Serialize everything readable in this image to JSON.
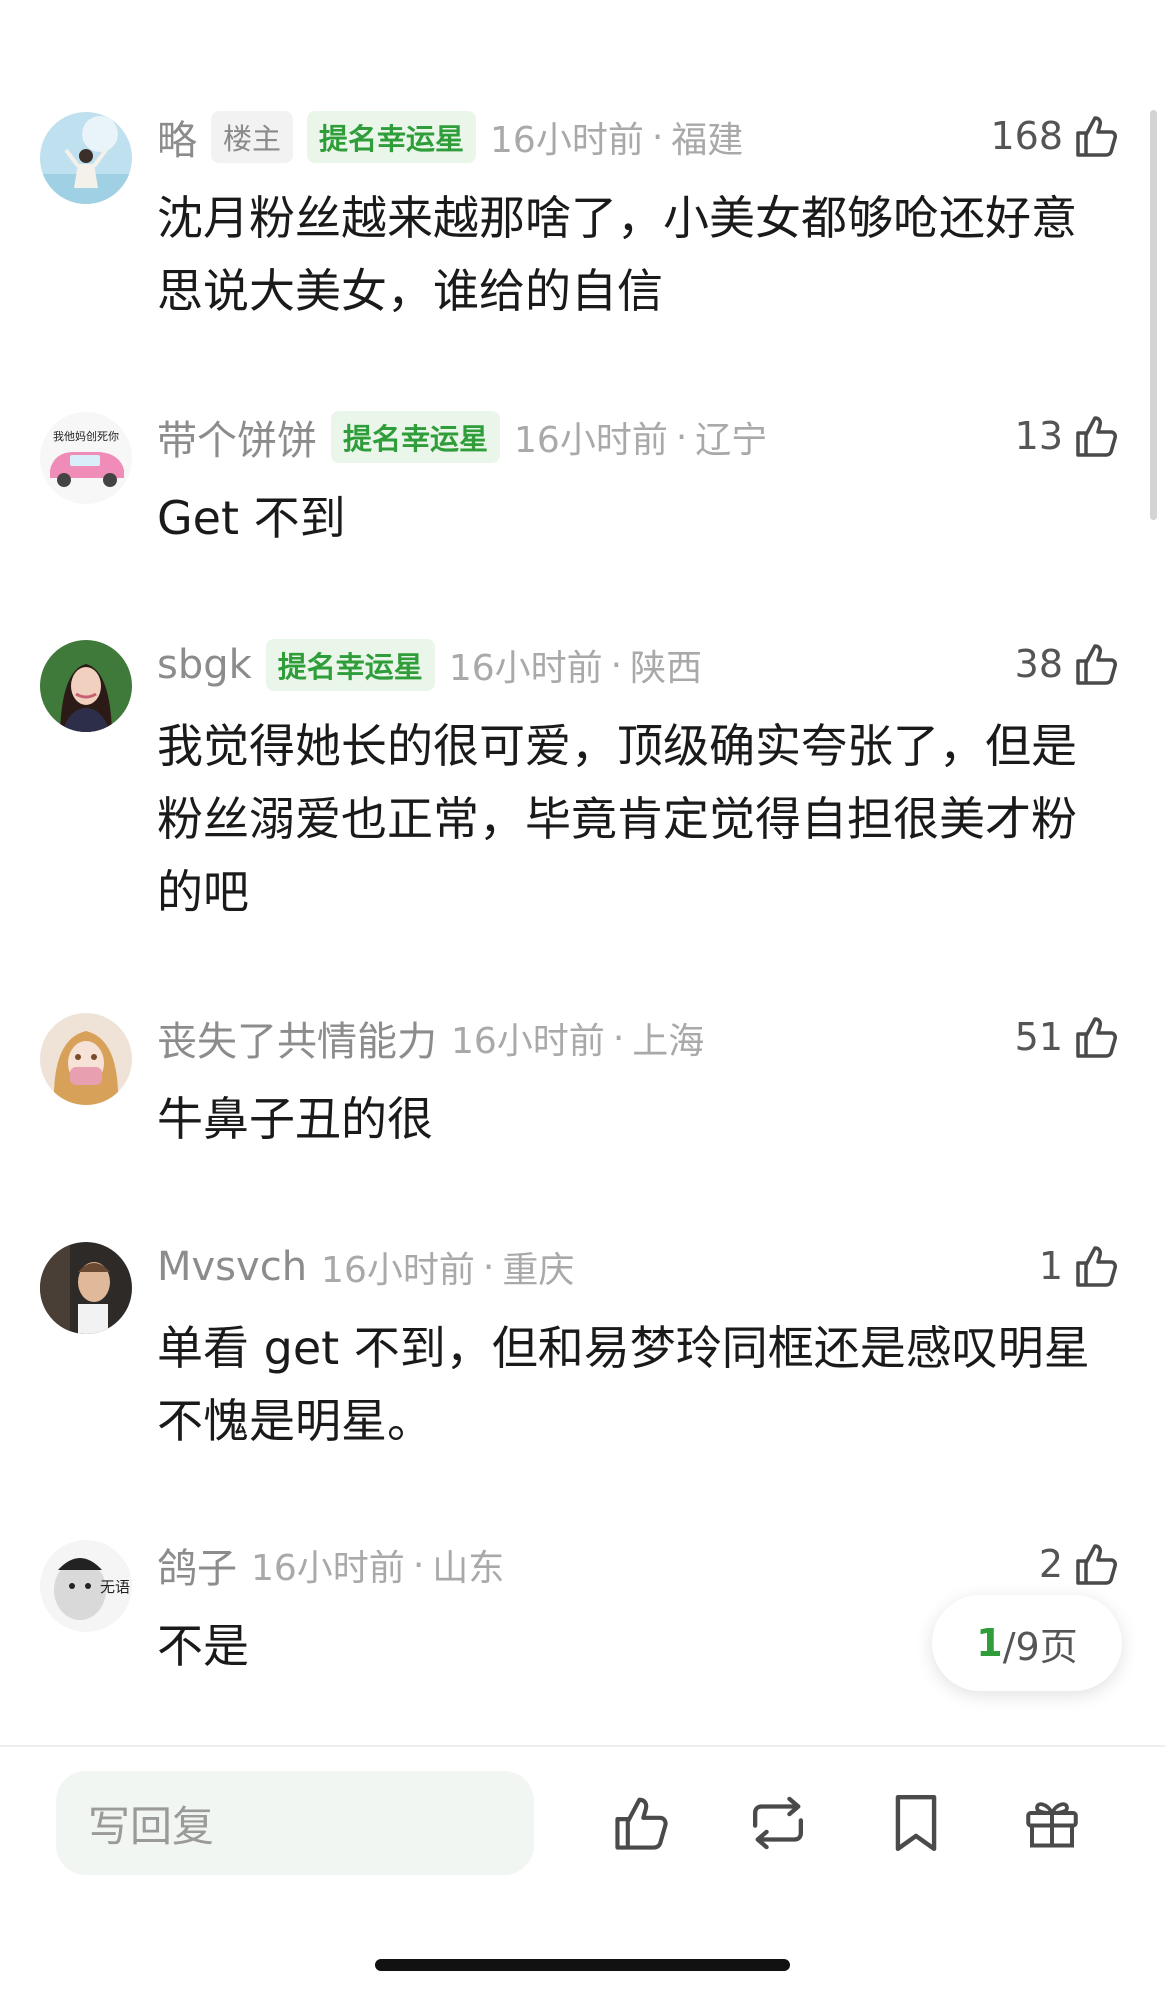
{
  "comments": [
    {
      "user": "略",
      "owner_badge": "楼主",
      "lucky_badge": "提名幸运星",
      "time": "16小时前",
      "region": "福建",
      "likes": "168",
      "text": "沈月粉丝越来越那啥了，小美女都够呛还好意思说大美女，谁给的自信"
    },
    {
      "user": "带个饼饼",
      "lucky_badge": "提名幸运星",
      "time": "16小时前",
      "region": "辽宁",
      "likes": "13",
      "text": "Get 不到",
      "avatar_text": "我他妈创死你"
    },
    {
      "user": "sbgk",
      "lucky_badge": "提名幸运星",
      "time": "16小时前",
      "region": "陕西",
      "likes": "38",
      "text": "我觉得她长的很可爱，顶级确实夸张了，但是粉丝溺爱也正常，毕竟肯定觉得自担很美才粉的吧"
    },
    {
      "user": "丧失了共情能力",
      "time": "16小时前",
      "region": "上海",
      "likes": "51",
      "text": "牛鼻子丑的很"
    },
    {
      "user": "Mvsvch",
      "time": "16小时前",
      "region": "重庆",
      "likes": "1",
      "text": "单看 get 不到，但和易梦玲同框还是感叹明星不愧是明星。"
    },
    {
      "user": "鸽子",
      "time": "16小时前",
      "region": "山东",
      "likes": "2",
      "text": "不是",
      "avatar_text": "无语"
    }
  ],
  "pagination": {
    "current": "1",
    "total": "/9页"
  },
  "bottom_bar": {
    "reply_placeholder": "写回复"
  },
  "colors": {
    "accent": "#2f9e3a",
    "badge_bg": "#e9f6e9"
  }
}
